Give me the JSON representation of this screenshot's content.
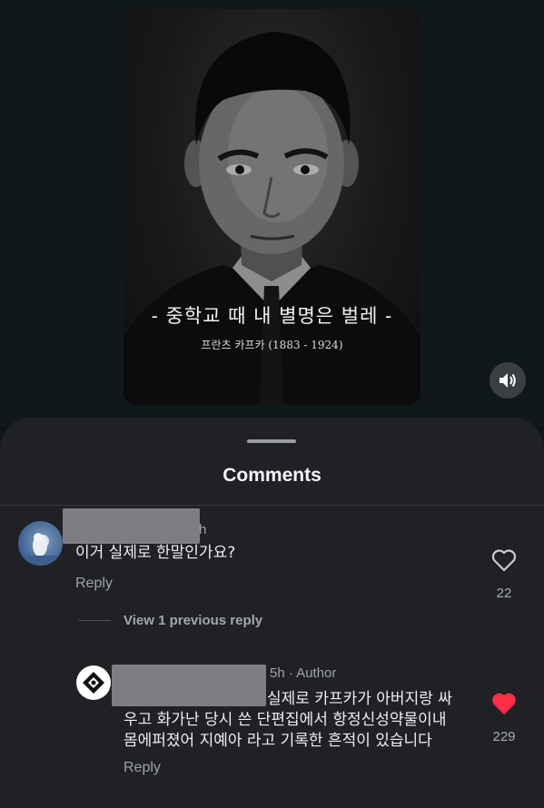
{
  "video": {
    "quote": "-  중학교 때 내 별명은 벌레  -",
    "quote_author": "프란츠 카프카 (1883 - 1924)",
    "sound_icon": "speaker-icon"
  },
  "comments_sheet": {
    "title": "Comments",
    "comments": [
      {
        "time": "h",
        "text": "이거 실제로 한말인가요?",
        "reply_label": "Reply",
        "likes": "22",
        "liked": false
      }
    ],
    "view_previous": "View 1 previous reply",
    "reply": {
      "meta": "5h · Author",
      "text_line1": "실제로 카프카가 아버지랑 싸",
      "text_line2": "우고 화가난 당시 쓴 단편집에서 항정신성약물이내",
      "text_line3": "몸에퍼졌어 지예아 라고 기록한 흔적이 있습니다",
      "reply_label": "Reply",
      "likes": "229",
      "liked": true
    }
  },
  "colors": {
    "heart_liked": "#ff2d46",
    "background": "#0f1519",
    "sheet": "#1f2125"
  }
}
